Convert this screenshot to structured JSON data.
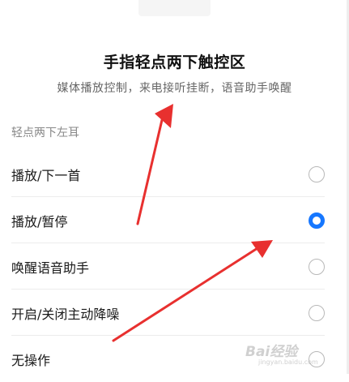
{
  "header": {
    "title": "手指轻点两下触控区",
    "subtitle": "媒体播放控制，来电接听挂断，语音助手唤醒"
  },
  "section": {
    "label": "轻点两下左耳"
  },
  "options": [
    {
      "label": "播放/下一首",
      "selected": false
    },
    {
      "label": "播放/暂停",
      "selected": true
    },
    {
      "label": "唤醒语音助手",
      "selected": false
    },
    {
      "label": "开启/关闭主动降噪",
      "selected": false
    },
    {
      "label": "无操作",
      "selected": false
    }
  ],
  "colors": {
    "accent": "#1677ff",
    "annotation_arrow": "#e8302f"
  },
  "watermark": {
    "line1": "Bai经验",
    "line2": "jingyan.baidu.com"
  }
}
